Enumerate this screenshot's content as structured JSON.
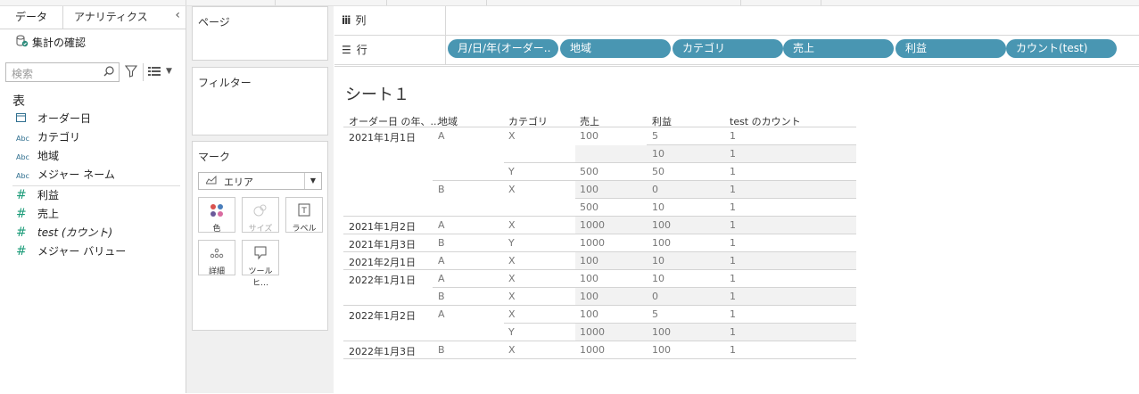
{
  "data_pane": {
    "tabs": [
      "データ",
      "アナリティクス"
    ],
    "datasource": "集計の確認",
    "search_placeholder": "検索",
    "section_title": "表",
    "dimensions": [
      {
        "icon": "calendar-icon",
        "label": "オーダー日"
      },
      {
        "icon": "abc-icon",
        "label": "カテゴリ"
      },
      {
        "icon": "abc-icon",
        "label": "地域"
      },
      {
        "icon": "abc-icon",
        "label": "メジャー ネーム"
      }
    ],
    "measures": [
      {
        "icon": "hash-icon",
        "label": "利益"
      },
      {
        "icon": "hash-icon",
        "label": "売上"
      },
      {
        "icon": "hash-icon",
        "label": "test (カウント)"
      },
      {
        "icon": "hash-icon",
        "label": "メジャー バリュー"
      }
    ]
  },
  "cards": {
    "pages": "ページ",
    "filters": "フィルター",
    "marks": "マーク",
    "mark_type": "エリア",
    "mark_buttons": [
      "色",
      "サイズ",
      "ラベル",
      "詳細",
      "ツールヒ…"
    ]
  },
  "shelves": {
    "columns_label": "列",
    "rows_label": "行",
    "row_pills": [
      "月/日/年(オーダー..",
      "地域",
      "カテゴリ",
      "売上",
      "利益",
      "カウント(test)"
    ]
  },
  "view": {
    "sheet_title": "シート１",
    "headers": [
      "オーダー日 の年、...",
      "地域",
      "カテゴリ",
      "売上",
      "利益",
      "test のカウント"
    ],
    "rows": [
      {
        "date": "2021年1月1日",
        "region": "A",
        "cat": "X",
        "sales": "100",
        "profit": "5",
        "count": "1"
      },
      {
        "date": "",
        "region": "",
        "cat": "",
        "sales": "",
        "profit": "10",
        "count": "1"
      },
      {
        "date": "",
        "region": "",
        "cat": "Y",
        "sales": "500",
        "profit": "50",
        "count": "1"
      },
      {
        "date": "",
        "region": "B",
        "cat": "X",
        "sales": "100",
        "profit": "0",
        "count": "1"
      },
      {
        "date": "",
        "region": "",
        "cat": "",
        "sales": "500",
        "profit": "10",
        "count": "1"
      },
      {
        "date": "2021年1月2日",
        "region": "A",
        "cat": "X",
        "sales": "1000",
        "profit": "100",
        "count": "1"
      },
      {
        "date": "2021年1月3日",
        "region": "B",
        "cat": "Y",
        "sales": "1000",
        "profit": "100",
        "count": "1"
      },
      {
        "date": "2021年2月1日",
        "region": "A",
        "cat": "X",
        "sales": "100",
        "profit": "10",
        "count": "1"
      },
      {
        "date": "2022年1月1日",
        "region": "A",
        "cat": "X",
        "sales": "100",
        "profit": "10",
        "count": "1"
      },
      {
        "date": "",
        "region": "B",
        "cat": "X",
        "sales": "100",
        "profit": "0",
        "count": "1"
      },
      {
        "date": "2022年1月2日",
        "region": "A",
        "cat": "X",
        "sales": "100",
        "profit": "5",
        "count": "1"
      },
      {
        "date": "",
        "region": "",
        "cat": "Y",
        "sales": "1000",
        "profit": "100",
        "count": "1"
      },
      {
        "date": "2022年1月3日",
        "region": "B",
        "cat": "X",
        "sales": "1000",
        "profit": "100",
        "count": "1"
      }
    ]
  }
}
